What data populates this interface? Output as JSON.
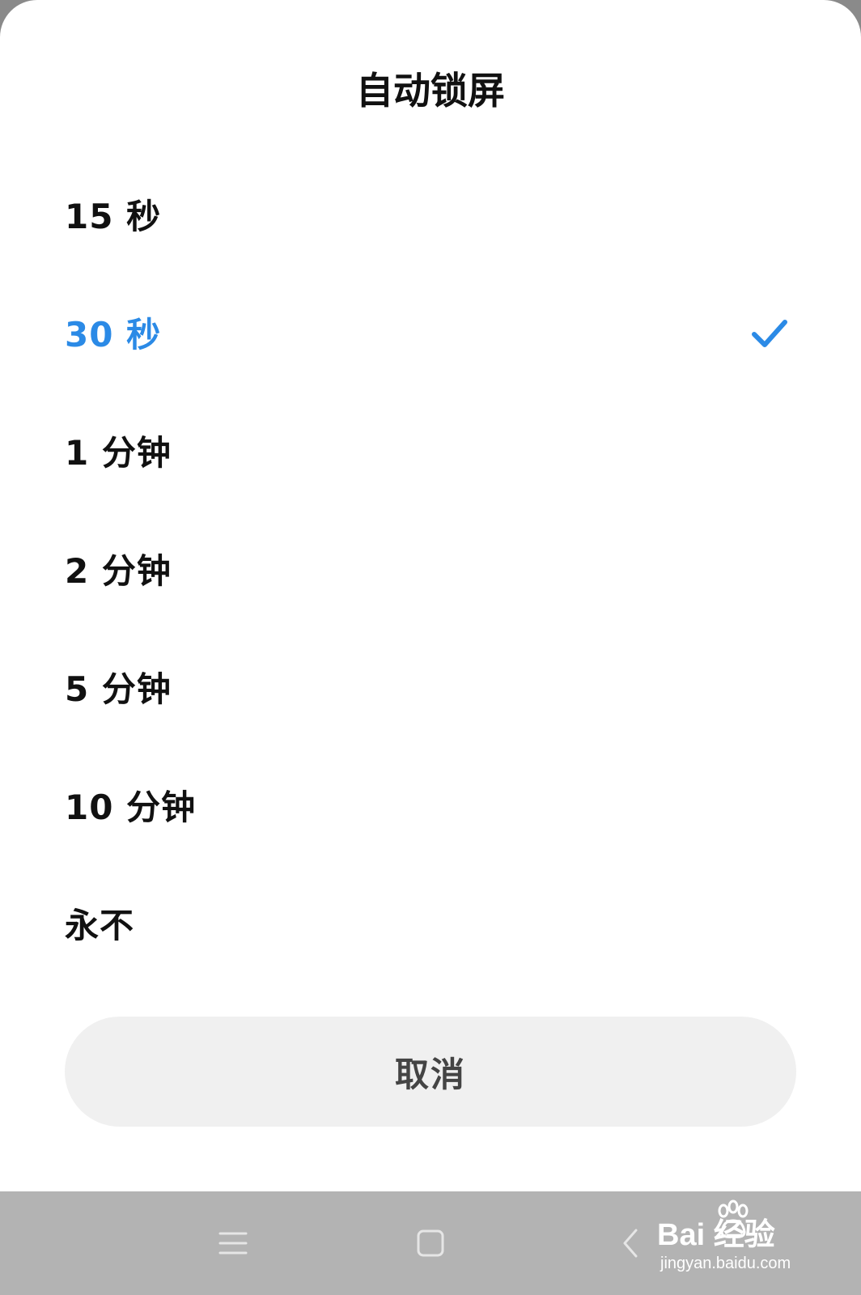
{
  "dialog": {
    "title": "自动锁屏",
    "options": [
      {
        "label": "15 秒",
        "selected": false
      },
      {
        "label": "30 秒",
        "selected": true
      },
      {
        "label": "1 分钟",
        "selected": false
      },
      {
        "label": "2 分钟",
        "selected": false
      },
      {
        "label": "5 分钟",
        "selected": false
      },
      {
        "label": "10 分钟",
        "selected": false
      },
      {
        "label": "永不",
        "selected": false
      }
    ],
    "cancel_label": "取消"
  },
  "colors": {
    "accent": "#2b8ae6",
    "text": "#111111",
    "cancel_bg": "#f0f0f0",
    "nav_bg": "#b3b3b3"
  },
  "nav": {
    "icons": [
      "menu-icon",
      "home-icon",
      "back-icon"
    ]
  },
  "watermark": {
    "logo_text": "Bai  经验",
    "url": "jingyan.baidu.com"
  }
}
